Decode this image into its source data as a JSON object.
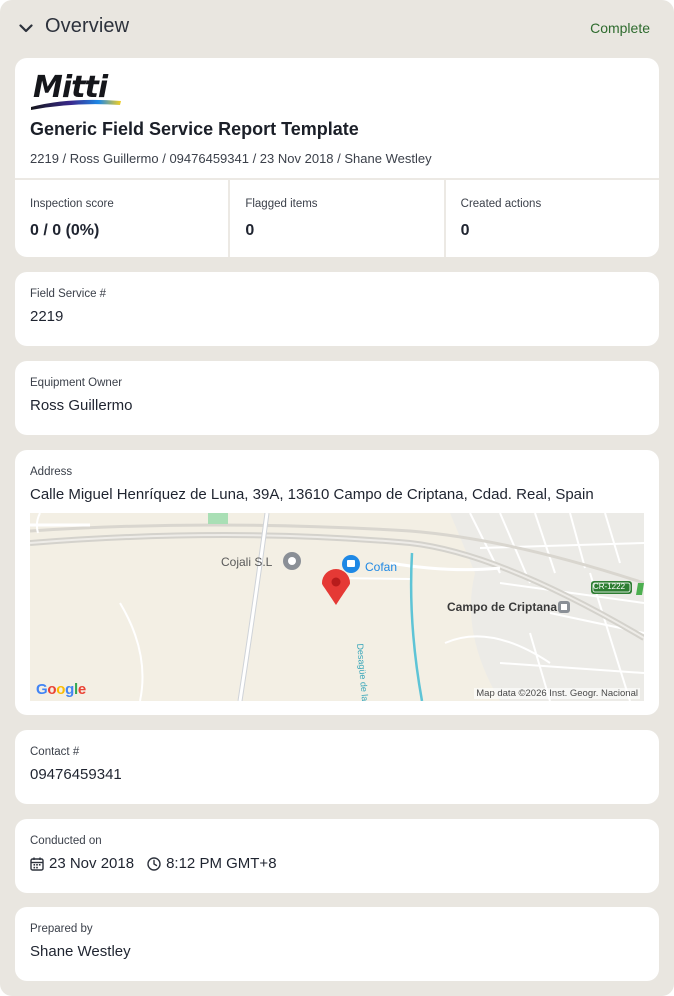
{
  "overview": {
    "title": "Overview",
    "status": "Complete"
  },
  "report": {
    "logo_text": "Mitti",
    "title": "Generic Field Service Report Template",
    "subtitle": "2219 / Ross Guillermo / 09476459341 / 23 Nov 2018 / Shane Westley",
    "stats": [
      {
        "label": "Inspection score",
        "value": "0 / 0 (0%)"
      },
      {
        "label": "Flagged items",
        "value": "0"
      },
      {
        "label": "Created actions",
        "value": "0"
      }
    ]
  },
  "fields": {
    "field_service": {
      "label": "Field Service #",
      "value": "2219"
    },
    "equipment_owner": {
      "label": "Equipment Owner",
      "value": "Ross Guillermo"
    },
    "address": {
      "label": "Address",
      "value": "Calle Miguel Henríquez de Luna, 39A, 13610 Campo de Criptana, Cdad. Real, Spain"
    },
    "contact": {
      "label": "Contact #",
      "value": "09476459341"
    },
    "conducted_on": {
      "label": "Conducted on",
      "date": "23 Nov 2018",
      "time": "8:12 PM GMT+8"
    },
    "prepared_by": {
      "label": "Prepared by",
      "value": "Shane Westley"
    }
  },
  "map": {
    "labels": {
      "cojali": "Cojali S.L",
      "cofan": "Cofan",
      "campo": "Campo de Criptana",
      "road": "CR-1222",
      "river": "Desagüe de la Depuradora"
    },
    "credit": "Map data ©2026 Inst. Geogr. Nacional",
    "google": [
      "G",
      "o",
      "o",
      "g",
      "l",
      "e"
    ],
    "colors": {
      "marker": "#e53935",
      "poi_blue": "#1e88e5",
      "water": "#5ec4d6",
      "road_badge": "#2e7d32"
    }
  },
  "colors": {
    "panel_bg": "#e9e6e0",
    "status_green": "#2e6b2e"
  }
}
